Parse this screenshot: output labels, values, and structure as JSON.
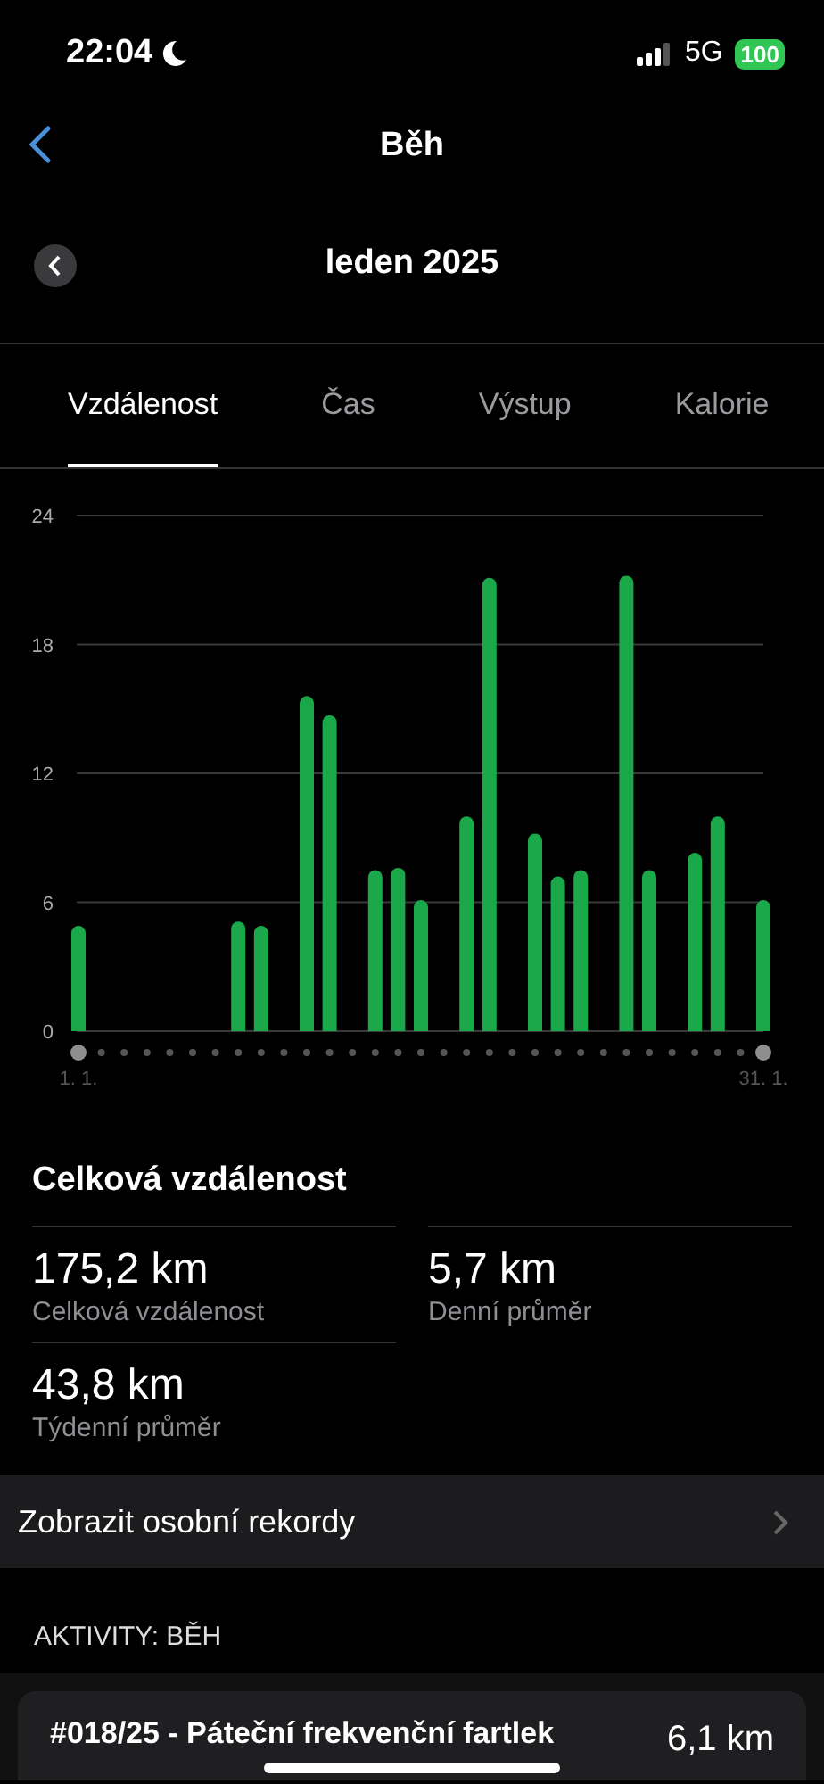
{
  "status_bar": {
    "time": "22:04",
    "network": "5G",
    "battery": "100"
  },
  "nav": {
    "title": "Běh"
  },
  "period": {
    "label": "leden 2025"
  },
  "tabs": [
    {
      "label": "Vzdálenost",
      "selected": true
    },
    {
      "label": "Čas",
      "selected": false
    },
    {
      "label": "Výstup",
      "selected": false
    },
    {
      "label": "Kalorie",
      "selected": false
    }
  ],
  "chart": {
    "chart_data": {
      "type": "bar",
      "categories": [
        "1. 1.",
        null,
        null,
        null,
        null,
        null,
        null,
        null,
        null,
        null,
        null,
        null,
        null,
        null,
        null,
        null,
        null,
        null,
        null,
        null,
        null,
        null,
        null,
        null,
        null,
        null,
        null,
        null,
        null,
        null,
        "31. 1."
      ],
      "series": [
        {
          "color": "#1aa84a",
          "values": [
            4.9,
            0,
            0,
            0,
            0,
            0,
            0,
            5.1,
            4.9,
            0,
            15.6,
            14.7,
            0,
            7.5,
            7.6,
            6.1,
            0,
            10.0,
            21.1,
            0,
            9.2,
            7.2,
            7.5,
            0,
            21.2,
            7.5,
            0,
            8.3,
            10.0,
            0,
            6.1
          ]
        }
      ],
      "ylim": [
        0,
        24
      ],
      "yticks": [
        0,
        6,
        12,
        18,
        24
      ],
      "grid": true
    }
  },
  "summary": {
    "title": "Celková vzdálenost",
    "stats": [
      {
        "value": "175,2 km",
        "label": "Celková vzdálenost"
      },
      {
        "value": "5,7 km",
        "label": "Denní průměr"
      },
      {
        "value": "43,8 km",
        "label": "Týdenní průměr"
      }
    ]
  },
  "records_link": {
    "label": "Zobrazit osobní rekordy"
  },
  "activities": {
    "header": "AKTIVITY: BĚH",
    "items": [
      {
        "title": "#018/25 - Páteční frekvenční fartlek",
        "distance": "6,1 km"
      }
    ]
  }
}
